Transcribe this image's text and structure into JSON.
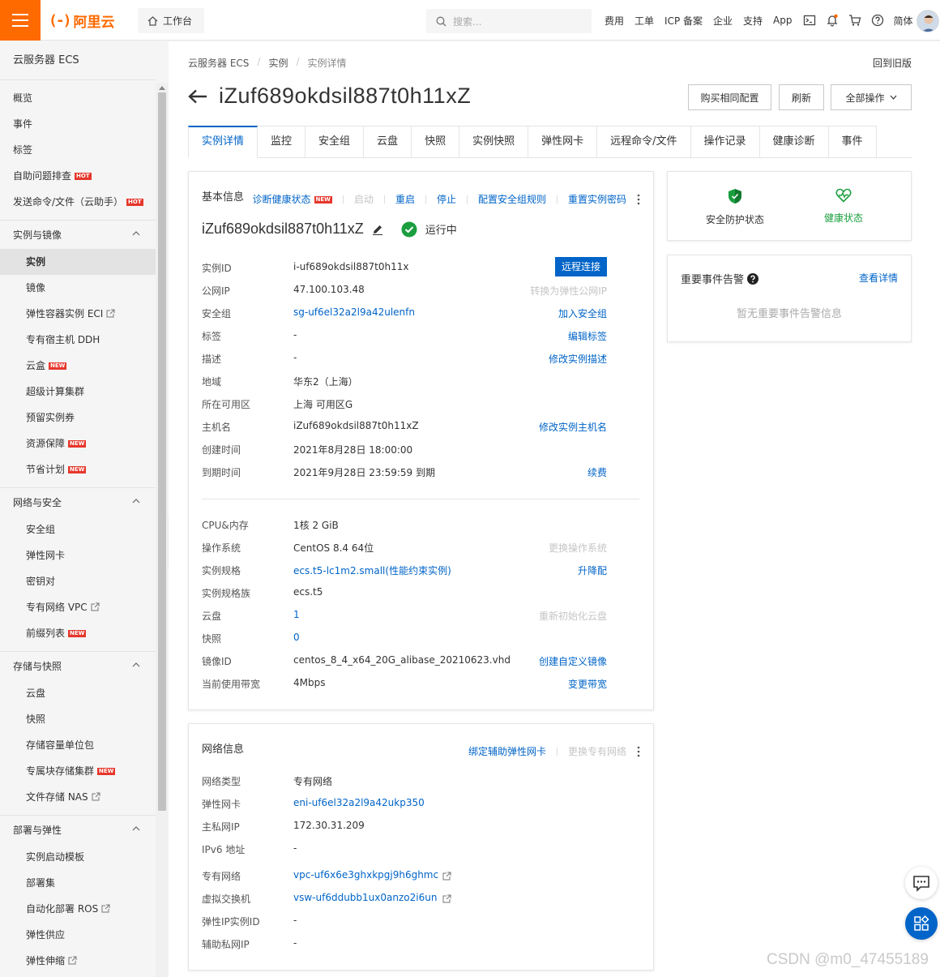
{
  "topbar": {
    "brand": "阿里云",
    "brand_mark": "(-)",
    "workbench": "工作台",
    "search_placeholder": "搜索...",
    "nav": [
      "费用",
      "工单",
      "ICP 备案",
      "企业",
      "支持",
      "App"
    ],
    "lang": "简体"
  },
  "sidebar": {
    "title": "云服务器 ECS",
    "top_items": [
      {
        "label": "概览"
      },
      {
        "label": "事件"
      },
      {
        "label": "标签"
      },
      {
        "label": "自助问题排查",
        "badge": "HOT"
      },
      {
        "label": "发送命令/文件（云助手）",
        "badge": "HOT"
      }
    ],
    "groups": [
      {
        "label": "实例与镜像",
        "items": [
          {
            "label": "实例",
            "active": true
          },
          {
            "label": "镜像"
          },
          {
            "label": "弹性容器实例 ECI",
            "external": true
          },
          {
            "label": "专有宿主机 DDH"
          },
          {
            "label": "云盒",
            "badge": "NEW"
          },
          {
            "label": "超级计算集群"
          },
          {
            "label": "预留实例券"
          },
          {
            "label": "资源保障",
            "badge": "NEW"
          },
          {
            "label": "节省计划",
            "badge": "NEW"
          }
        ]
      },
      {
        "label": "网络与安全",
        "items": [
          {
            "label": "安全组"
          },
          {
            "label": "弹性网卡"
          },
          {
            "label": "密钥对"
          },
          {
            "label": "专有网络 VPC",
            "external": true
          },
          {
            "label": "前缀列表",
            "badge": "NEW"
          }
        ]
      },
      {
        "label": "存储与快照",
        "items": [
          {
            "label": "云盘"
          },
          {
            "label": "快照"
          },
          {
            "label": "存储容量单位包"
          },
          {
            "label": "专属块存储集群",
            "badge": "NEW"
          },
          {
            "label": "文件存储 NAS",
            "external": true
          }
        ]
      },
      {
        "label": "部署与弹性",
        "items": [
          {
            "label": "实例启动模板"
          },
          {
            "label": "部署集"
          },
          {
            "label": "自动化部署 ROS",
            "external": true
          },
          {
            "label": "弹性供应"
          },
          {
            "label": "弹性伸缩",
            "external": true
          }
        ]
      }
    ]
  },
  "breadcrumb": [
    "云服务器 ECS",
    "实例",
    "实例详情"
  ],
  "old_version": "回到旧版",
  "page_title": "iZuf689okdsil887t0h11xZ",
  "header_buttons": {
    "buy_same": "购买相同配置",
    "refresh": "刷新",
    "all_ops": "全部操作"
  },
  "tabs": [
    "实例详情",
    "监控",
    "安全组",
    "云盘",
    "快照",
    "实例快照",
    "弹性网卡",
    "远程命令/文件",
    "操作记录",
    "健康诊断",
    "事件"
  ],
  "basic": {
    "title": "基本信息",
    "actions": [
      {
        "label": "诊断健康状态",
        "badge": "NEW",
        "enabled": true
      },
      {
        "label": "启动",
        "enabled": false
      },
      {
        "label": "重启",
        "enabled": true
      },
      {
        "label": "停止",
        "enabled": true
      },
      {
        "label": "配置安全组规则",
        "enabled": true
      },
      {
        "label": "重置实例密码",
        "enabled": true
      }
    ],
    "instance_name": "iZuf689okdsil887t0h11xZ",
    "status": "运行中",
    "remote_connect": "远程连接",
    "rows1": [
      {
        "k": "实例ID",
        "v": "i-uf689okdsil887t0h11x",
        "op": ""
      },
      {
        "k": "公网IP",
        "v": "47.100.103.48",
        "op": "转换为弹性公网IP",
        "op_disabled": true
      },
      {
        "k": "安全组",
        "v": "sg-uf6el32a2l9a42ulenfn",
        "v_link": true,
        "op": "加入安全组"
      },
      {
        "k": "标签",
        "v": "-",
        "op": "编辑标签"
      },
      {
        "k": "描述",
        "v": "-",
        "op": "修改实例描述"
      },
      {
        "k": "地域",
        "v": "华东2（上海）",
        "op": ""
      },
      {
        "k": "所在可用区",
        "v": "上海 可用区G",
        "op": ""
      },
      {
        "k": "主机名",
        "v": "iZuf689okdsil887t0h11xZ",
        "op": "修改实例主机名"
      },
      {
        "k": "创建时间",
        "v": "2021年8月28日 18:00:00",
        "op": ""
      },
      {
        "k": "到期时间",
        "v": "2021年9月28日 23:59:59 到期",
        "op": "续费"
      }
    ],
    "rows2": [
      {
        "k": "CPU&内存",
        "v": "1核 2 GiB",
        "op": ""
      },
      {
        "k": "操作系统",
        "v": "CentOS 8.4 64位",
        "op": "更换操作系统",
        "op_disabled": true
      },
      {
        "k": "实例规格",
        "v": "ecs.t5-lc1m2.small(性能约束实例)",
        "v_link": true,
        "op": "升降配"
      },
      {
        "k": "实例规格族",
        "v": "ecs.t5",
        "op": ""
      },
      {
        "k": "云盘",
        "v": "1",
        "v_link": true,
        "op": "重新初始化云盘",
        "op_disabled": true
      },
      {
        "k": "快照",
        "v": "0",
        "v_link": true,
        "op": ""
      },
      {
        "k": "镜像ID",
        "v": "centos_8_4_x64_20G_alibase_20210623.vhd",
        "op": "创建自定义镜像"
      },
      {
        "k": "当前使用带宽",
        "v": "4Mbps",
        "op": "变更带宽"
      }
    ]
  },
  "network": {
    "title": "网络信息",
    "actions": [
      {
        "label": "绑定辅助弹性网卡",
        "enabled": true
      },
      {
        "label": "更换专有网络",
        "enabled": false
      }
    ],
    "rows": [
      {
        "k": "网络类型",
        "v": "专有网络"
      },
      {
        "k": "弹性网卡",
        "v": "eni-uf6el32a2l9a42ukp350",
        "v_link": true
      },
      {
        "k": "主私网IP",
        "v": "172.30.31.209"
      },
      {
        "k": "IPv6 地址",
        "v": "-"
      },
      {
        "k": "专有网络",
        "v": "vpc-uf6x6e3ghxkpgj9h6ghmc",
        "v_link": true,
        "external": true
      },
      {
        "k": "虚拟交换机",
        "v": "vsw-uf6ddubb1ux0anzo2i6un",
        "v_link": true,
        "external": true
      },
      {
        "k": "弹性IP实例ID",
        "v": "-"
      },
      {
        "k": "辅助私网IP",
        "v": "-"
      }
    ]
  },
  "status_panel": {
    "security": "安全防护状态",
    "health": "健康状态"
  },
  "events_panel": {
    "title": "重要事件告警",
    "link": "查看详情",
    "empty": "暂无重要事件告警信息"
  },
  "watermark": "CSDN @m0_47455189",
  "colors": {
    "brand": "#ff6a00",
    "link": "#0064c8",
    "ok": "#1a9e3f",
    "hot": "#e6372c"
  }
}
